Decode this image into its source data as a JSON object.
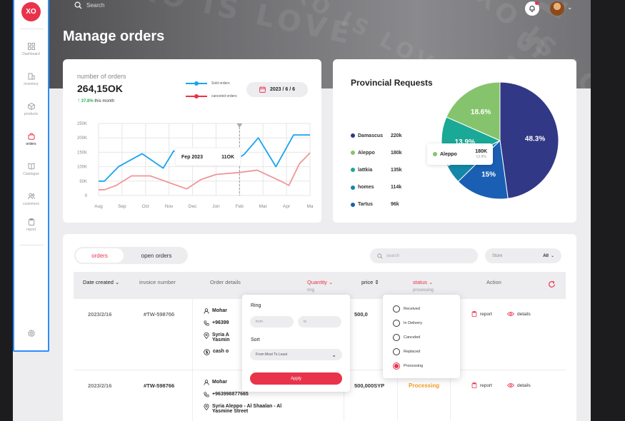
{
  "header": {
    "title": "Manage orders",
    "search_placeholder": "Search",
    "watermark": "XO IS LOVE"
  },
  "sidebar": {
    "logo": "XO",
    "items": [
      {
        "label": "Dashboard",
        "icon": "grid-icon"
      },
      {
        "label": "inventory",
        "icon": "building-icon"
      },
      {
        "label": "products",
        "icon": "box-icon"
      },
      {
        "label": "orders",
        "icon": "bag-icon",
        "active": true
      },
      {
        "label": "Catalogue",
        "icon": "book-icon"
      },
      {
        "label": "customers",
        "icon": "users-icon"
      },
      {
        "label": "report",
        "icon": "clipboard-icon"
      }
    ]
  },
  "orders_card": {
    "label": "number of orders",
    "value": "264,15OK",
    "growth_pct": "37.8%",
    "growth_text": "this month",
    "legend_sold": "Sold orders",
    "legend_canceled": "canceled orders",
    "date": "2023 / 6 / 6",
    "tooltip_label": "Fep  2023",
    "tooltip_value": "11OK"
  },
  "chart_data": {
    "type": "line",
    "categories": [
      "Aug",
      "Sep",
      "Oct",
      "Nov",
      "Dec",
      "Jon",
      "Feb",
      "Mar",
      "Apr",
      "Ma"
    ],
    "y_ticks": [
      "250K",
      "200K",
      "150K",
      "100K",
      "50K",
      "0"
    ],
    "ylim": [
      0,
      250
    ],
    "grid": true,
    "series": [
      {
        "name": "Sold orders",
        "color": "#1aa3f0",
        "x": [
          0,
          0.25,
          0.85,
          1.85,
          2.75,
          3.2,
          3.55,
          4.25,
          4.55,
          5.25,
          5.75,
          6.2,
          6.8,
          7.55,
          8.3,
          8.55,
          9.0
        ],
        "y": [
          50,
          50,
          100,
          145,
          95,
          155,
          140,
          108,
          110,
          105,
          118,
          143,
          200,
          100,
          210,
          210,
          210
        ]
      },
      {
        "name": "canceled orders",
        "color": "#f0969a",
        "x": [
          0,
          0.25,
          0.75,
          1.4,
          2.2,
          3.75,
          4.35,
          5.0,
          6.0,
          6.75,
          7.8,
          8.1,
          8.55,
          9.0
        ],
        "y": [
          20,
          20,
          35,
          68,
          68,
          23,
          55,
          73,
          80,
          88,
          48,
          35,
          110,
          148
        ]
      }
    ],
    "highlight_category": "Feb"
  },
  "provincial": {
    "title": "Provincial Requests",
    "rows": [
      {
        "name": "Damascus",
        "value": "220k",
        "color": "#313885"
      },
      {
        "name": "Aleppo",
        "value": "180k",
        "color": "#85c46c"
      },
      {
        "name": "lattkia",
        "value": "135k",
        "color": "#1aa897"
      },
      {
        "name": "homes",
        "value": "114k",
        "color": "#1487a8"
      },
      {
        "name": "Tartus",
        "value": "96k",
        "color": "#1a5fb3"
      }
    ],
    "pie": [
      {
        "label": "48.3%",
        "value": 48.3,
        "color": "#313885"
      },
      {
        "label": "15%",
        "value": 15,
        "color": "#1a5fb3"
      },
      {
        "label": "",
        "value": 5.2,
        "color": "#1487a8"
      },
      {
        "label": "13.9%",
        "value": 13.9,
        "color": "#1aa897"
      },
      {
        "label": "18.6%",
        "value": 18.6,
        "color": "#85c46c"
      }
    ],
    "tooltip": {
      "name": "Aleppo",
      "value": "180K",
      "pct": "13.9%"
    }
  },
  "orders_table": {
    "tabs": [
      "orders",
      "open orders"
    ],
    "search_placeholder": "search",
    "store_label": "Store",
    "store_value": "All",
    "columns": {
      "date": "Date created",
      "invoice": "invoice number",
      "details": "Order details",
      "quantity": "Quantity",
      "quantity_sub": "ring",
      "price": "price",
      "status": "status",
      "status_sub": "processing",
      "action": "Action"
    },
    "rows": [
      {
        "date": "2023/2/16",
        "invoice": "#TW-598766",
        "name": "Mohar",
        "phone": "+96399",
        "address_1": "Syria A",
        "address_2": "Yasmin",
        "payment": "cash o",
        "price": "500,0",
        "status": "",
        "report": "report",
        "details_link": "details"
      },
      {
        "date": "2023/2/16",
        "invoice": "#TW-598766",
        "name": "Mohar",
        "phone": "+963998877665",
        "address_1": "Syria Aleppo - Al Shaalan - Al",
        "address_2": "Yasmine Street",
        "price": "500,000SYP",
        "status": "Processing",
        "report": "report",
        "details_link": "details"
      }
    ],
    "filter_popover": {
      "ring_label": "Ring",
      "from_placeholder": "from",
      "to_placeholder": "to",
      "sort_label": "Sort",
      "sort_value": "From Most To Least",
      "apply": "Apply"
    },
    "status_popover": {
      "options": [
        "Received",
        "In Delivery",
        "Canceled",
        "Replaced",
        "Processing"
      ],
      "selected": "Processing"
    }
  }
}
